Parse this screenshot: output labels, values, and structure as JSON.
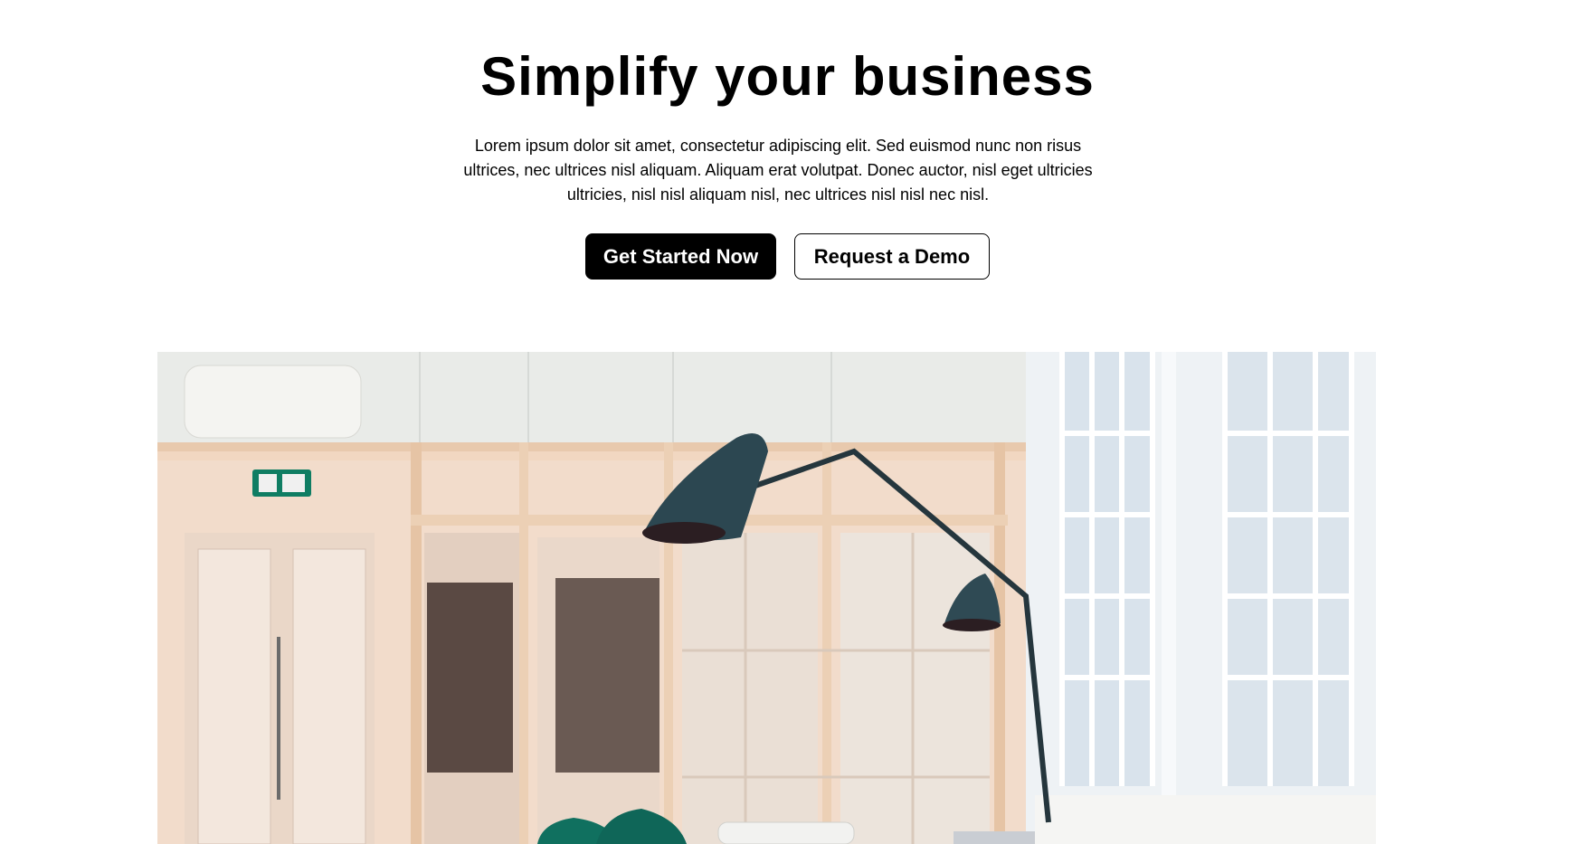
{
  "hero": {
    "title": "Simplify your business",
    "description": "Lorem ipsum dolor sit amet, consectetur adipiscing elit. Sed euismod nunc non risus ultrices, nec ultrices nisl aliquam. Aliquam erat volutpat. Donec auctor, nisl eget ultricies ultricies, nisl nisl aliquam nisl, nec ultrices nisl nisl nec nisl.",
    "primary_button": "Get Started Now",
    "secondary_button": "Request a Demo"
  },
  "colors": {
    "primary_bg": "#000000",
    "primary_text": "#ffffff",
    "secondary_border": "#000000"
  },
  "icons": [
    "office-photo"
  ]
}
